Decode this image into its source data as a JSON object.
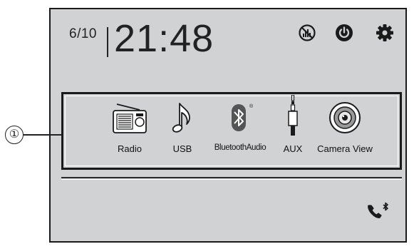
{
  "header": {
    "date": "6/10",
    "time": "21:48"
  },
  "top_icons": [
    "no-signal-icon",
    "power-icon",
    "settings-gear-icon"
  ],
  "callout": "①",
  "sources": [
    {
      "label": "Radio",
      "icon": "radio-icon"
    },
    {
      "label": "USB",
      "icon": "music-note-icon"
    },
    {
      "label": "BluetoothAudio",
      "icon": "bluetooth-icon"
    },
    {
      "label": "AUX",
      "icon": "aux-jack-icon"
    },
    {
      "label": "Camera View",
      "icon": "camera-icon"
    }
  ],
  "bottom": {
    "icon": "bluetooth-phone-icon"
  },
  "colors": {
    "screen": "#d1d2d4",
    "icon_dark": "#1a1a1a"
  }
}
